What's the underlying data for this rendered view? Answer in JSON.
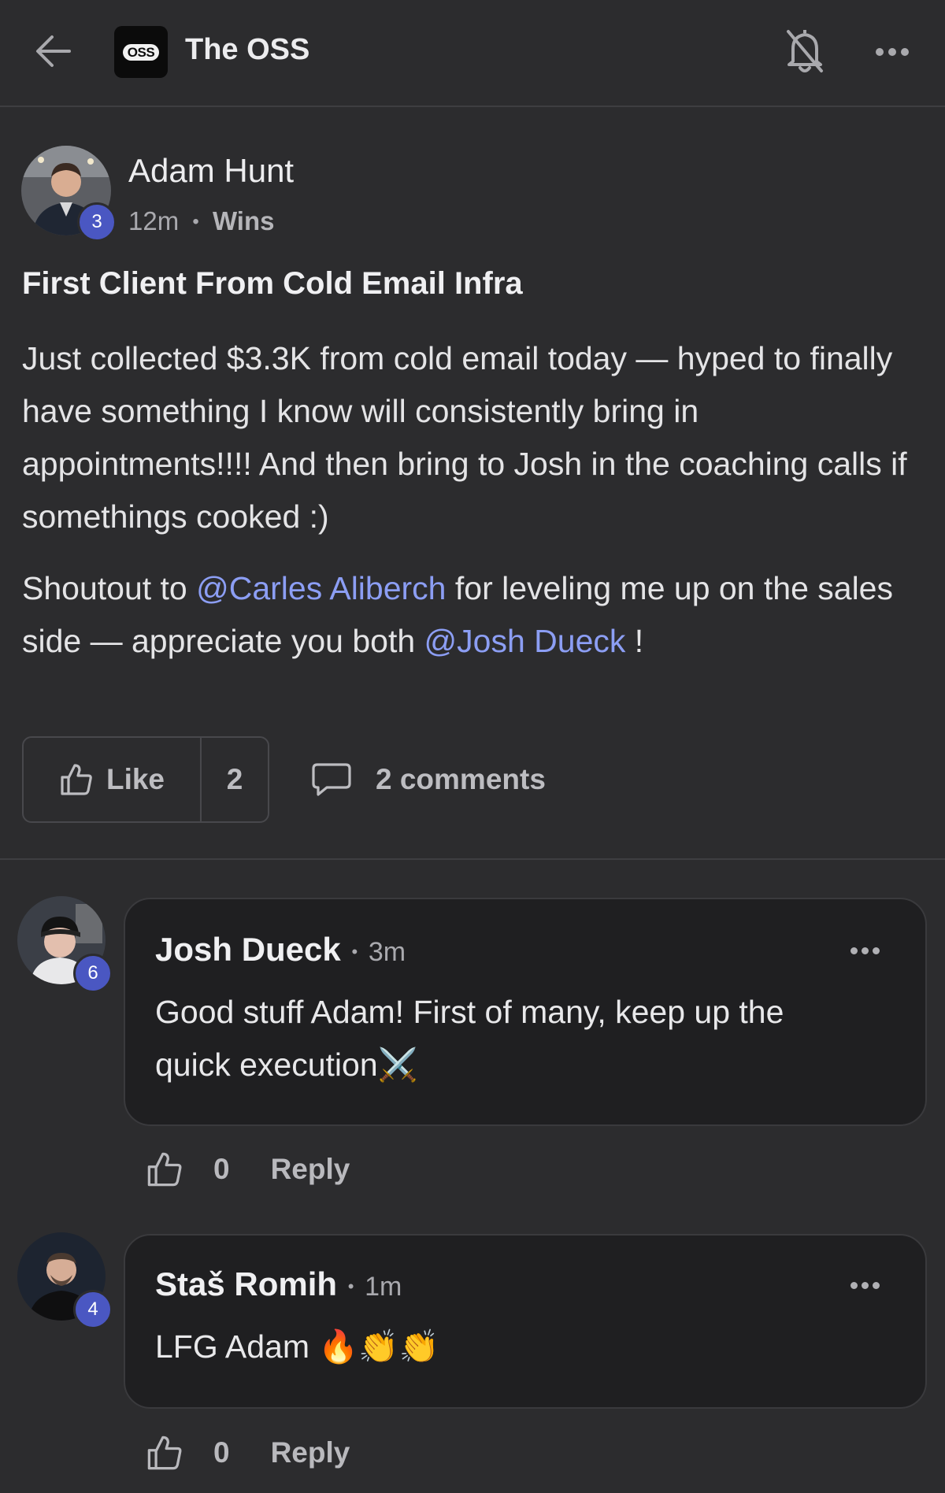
{
  "header": {
    "group_logo_text": "OSS",
    "group_name": "The OSS"
  },
  "post": {
    "author": "Adam Hunt",
    "author_level": "3",
    "time": "12m",
    "separator": "•",
    "category": "Wins",
    "title": "First Client From Cold Email Infra",
    "body_paragraph_1": "Just collected $3.3K from cold email today — hyped to finally have something I know will consistently bring in appointments!!!! And then bring to Josh in the coaching calls if somethings cooked :)",
    "body_p2_part1": "Shoutout to ",
    "mention_1": "@Carles Aliberch",
    "body_p2_part2": " for leveling me up on the sales side — appreciate you both ",
    "mention_2": "@Josh Dueck",
    "body_p2_part3": " !",
    "like_label": "Like",
    "like_count": "2",
    "comments_label": "2 comments"
  },
  "comments": [
    {
      "author": "Josh Dueck",
      "level": "6",
      "time": "3m",
      "text": "Good stuff Adam! First of many, keep up the quick execution⚔️",
      "like_count": "0",
      "reply_label": "Reply"
    },
    {
      "author": "Staš Romih",
      "level": "4",
      "time": "1m",
      "text": "LFG Adam 🔥👏👏",
      "like_count": "0",
      "reply_label": "Reply"
    }
  ],
  "colors": {
    "background": "#2c2c2e",
    "mention": "#8c9ef4",
    "level_badge": "#4a57c2",
    "comment_card": "#1f1f21"
  },
  "icons": [
    "back-arrow-icon",
    "bell-off-icon",
    "more-icon",
    "thumbs-up-icon",
    "comment-icon"
  ]
}
